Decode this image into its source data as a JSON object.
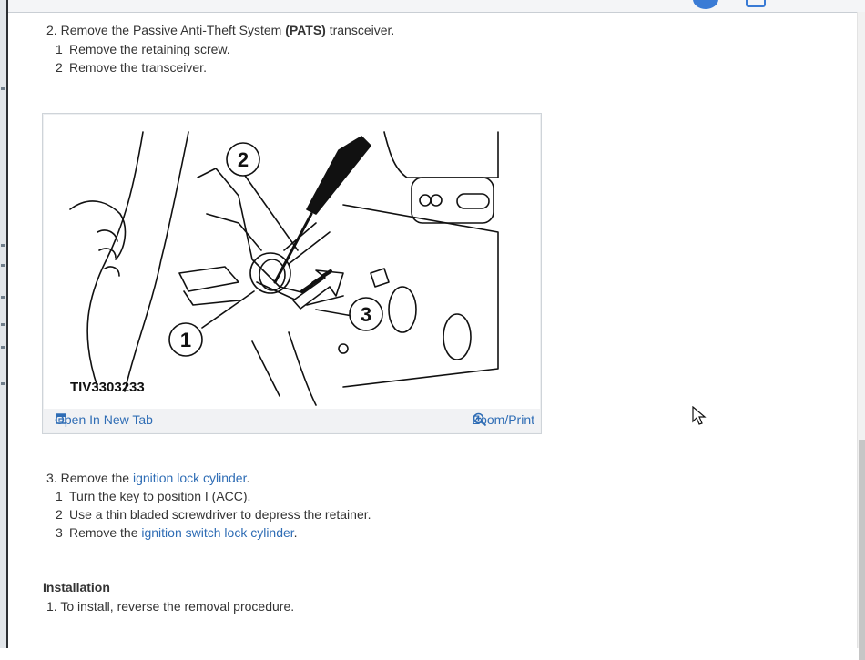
{
  "step2": {
    "number": "2.",
    "text_before": "Remove the Passive Anti-Theft System ",
    "bold": "(PATS)",
    "text_after": " transceiver.",
    "substeps": [
      {
        "n": "1",
        "text": "Remove the retaining screw."
      },
      {
        "n": "2",
        "text": "Remove the transceiver."
      }
    ]
  },
  "figure": {
    "caption": "TIV3303233",
    "callouts": [
      "1",
      "2",
      "3"
    ],
    "open_label": "Open In New Tab",
    "zoom_label": "Zoom/Print",
    "open_icon": "external-tab-icon",
    "zoom_icon": "magnifier-plus-icon"
  },
  "step3": {
    "number": "3.",
    "text_before": "Remove the ",
    "link": "ignition lock cylinder",
    "text_after": ".",
    "substeps": [
      {
        "n": "1",
        "text": "Turn the key to position I (ACC)."
      },
      {
        "n": "2",
        "text": "Use a thin bladed screwdriver to depress the retainer."
      },
      {
        "n": "3",
        "text_before": "Remove the ",
        "link": "ignition switch lock cylinder",
        "text_after": "."
      }
    ]
  },
  "installation": {
    "heading": "Installation",
    "number": "1.",
    "text": "To install, reverse the removal procedure."
  },
  "colors": {
    "link": "#2f6db5",
    "text": "#333333",
    "accent": "#3a7bd5"
  }
}
